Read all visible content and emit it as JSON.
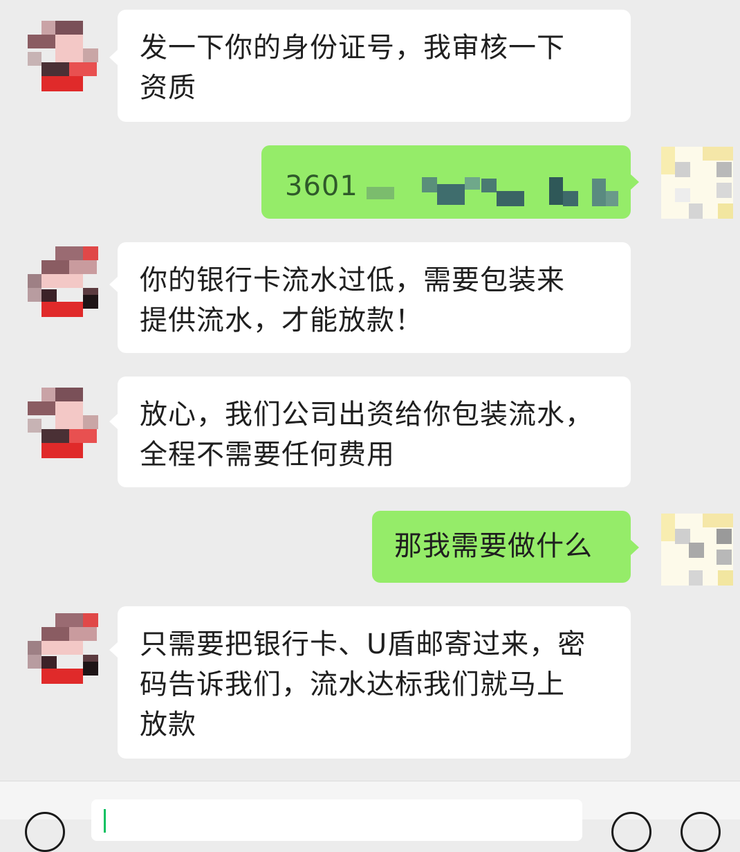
{
  "messages": [
    {
      "side": "in",
      "lines": [
        "发一下你的身份证号，我审核一下",
        "资质"
      ]
    },
    {
      "side": "out",
      "text": "3601"
    },
    {
      "side": "in",
      "lines": [
        "你的银行卡流水过低，需要包装来",
        "提供流水，才能放款！"
      ]
    },
    {
      "side": "in",
      "lines": [
        "放心，我们公司出资给你包装流水，",
        "全程不需要任何费用"
      ]
    },
    {
      "side": "out",
      "text": "那我需要做什么"
    },
    {
      "side": "in",
      "lines": [
        "只需要把银行卡、U盾邮寄过来，密",
        "码告诉我们，流水达标我们就马上",
        "放款"
      ]
    }
  ],
  "input_bar": {
    "left_icon": "voice-icon",
    "right_icons": [
      "emoji-icon",
      "plus-icon"
    ],
    "input_value": ""
  },
  "colors": {
    "background": "#ececec",
    "incoming_bubble": "#ffffff",
    "outgoing_bubble": "#95ec69",
    "sender_avatar_red": "#e02a2a"
  }
}
